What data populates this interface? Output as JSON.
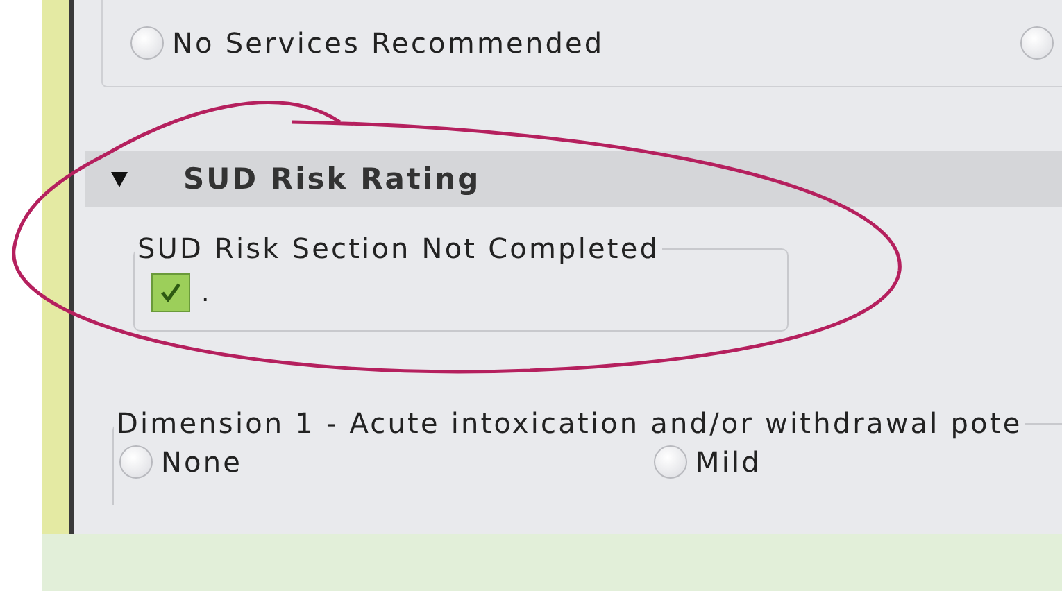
{
  "top_group": {
    "options": [
      {
        "label": "No Services Recommended",
        "selected": false
      },
      {
        "selected": false
      }
    ]
  },
  "section": {
    "title": "SUD Risk Rating",
    "expanded": true,
    "not_completed": {
      "legend": "SUD Risk Section Not Completed",
      "checked": true,
      "text": "."
    },
    "dimension_1": {
      "legend": "Dimension 1 -  Acute intoxication and/or withdrawal pote",
      "options": [
        {
          "label": "None",
          "selected": false
        },
        {
          "label": "Mild",
          "selected": false
        }
      ]
    }
  },
  "annotation": {
    "kind": "ellipse"
  }
}
